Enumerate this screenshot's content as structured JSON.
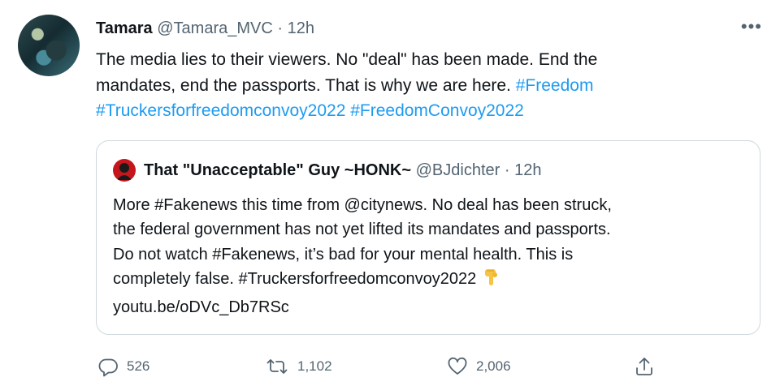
{
  "tweet": {
    "display_name": "Tamara",
    "handle": "@Tamara_MVC",
    "separator": "·",
    "time": "12h",
    "more_label": "•••",
    "text_lines": [
      [
        "The media lies to their viewers. No \"deal\" has been made. End the"
      ],
      [
        "mandates, end the passports. That is why we are here. ",
        "#Freedom"
      ],
      [
        "#Truckersforfreedomconvoy2022",
        " ",
        "#FreedomConvoy2022"
      ]
    ]
  },
  "quoted": {
    "display_name": "That \"Unacceptable\" Guy ~HONK~",
    "handle": "@BJdichter",
    "separator": "·",
    "time": "12h",
    "text_lines": [
      "More #Fakenews this time from @citynews.  No deal has been struck,",
      "the federal government has not yet  lifted its mandates and passports.",
      "Do not watch #Fakenews, it’s bad for your mental health. This is",
      "completely false. #Truckersforfreedomconvoy2022",
      "youtu.be/oDVc_Db7RSc"
    ],
    "emoji_icon": "pointing-down-emoji"
  },
  "actions": {
    "reply_count": "526",
    "retweet_count": "1,102",
    "like_count": "2,006",
    "share_icon": "share-icon"
  },
  "colors": {
    "text": "#0f1419",
    "secondary": "#536471",
    "link": "#1d9bf0",
    "border": "#cfd9de"
  }
}
